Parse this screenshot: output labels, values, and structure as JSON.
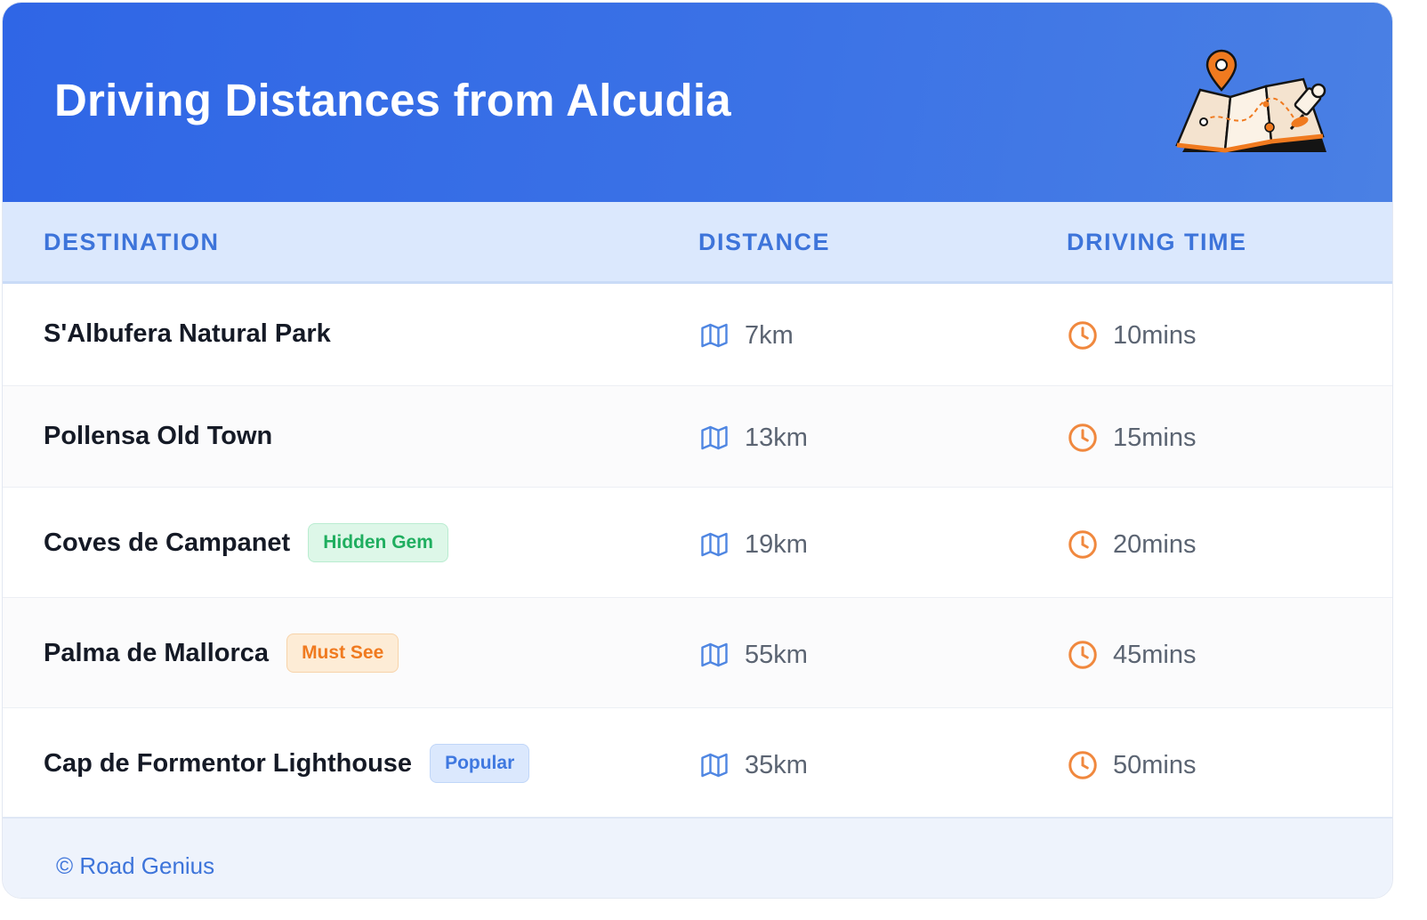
{
  "header": {
    "title": "Driving Distances from Alcudia",
    "illustration": "treasure-map-pin-icon"
  },
  "table": {
    "columns": [
      "DESTINATION",
      "DISTANCE",
      "DRIVING TIME"
    ],
    "distance_icon": "map-icon",
    "time_icon": "clock-icon",
    "rows": [
      {
        "destination": "S'Albufera Natural Park",
        "badge": "",
        "distance": "7km",
        "time": "10mins"
      },
      {
        "destination": "Pollensa Old Town",
        "badge": "",
        "distance": "13km",
        "time": "15mins"
      },
      {
        "destination": "Coves de Campanet",
        "badge": "Hidden Gem",
        "distance": "19km",
        "time": "20mins"
      },
      {
        "destination": "Palma de Mallorca",
        "badge": "Must See",
        "distance": "55km",
        "time": "45mins"
      },
      {
        "destination": "Cap de Formentor Lighthouse",
        "badge": "Popular",
        "distance": "35km",
        "time": "50mins"
      }
    ]
  },
  "footer": {
    "copyright": "© Road Genius"
  },
  "colors": {
    "header_blue": "#2f66e6",
    "accent_blue": "#3d74da",
    "badge_green": "#1fae5f",
    "badge_orange": "#f07a1f",
    "clock_orange": "#f0883e"
  }
}
